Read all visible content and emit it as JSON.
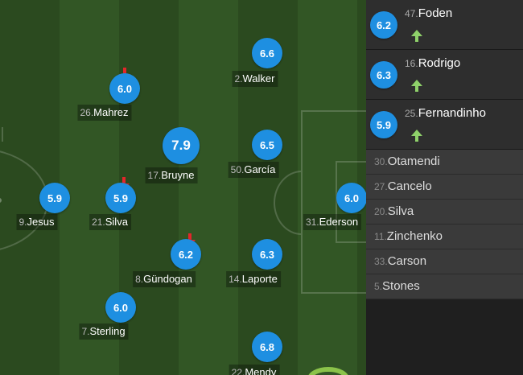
{
  "colors": {
    "rating": "#1e8fe1",
    "sub_out_arrow": "#e3262b",
    "sub_in_arrow": "#8fd16a",
    "pitch_dark": "#2b4a1f",
    "pitch_light": "#325625"
  },
  "lineup": [
    {
      "id": "mahrez",
      "number": "26.",
      "name": "Mahrez",
      "rating": "6.0",
      "subbed_off": true
    },
    {
      "id": "walker",
      "number": "2.",
      "name": "Walker",
      "rating": "6.6"
    },
    {
      "id": "bruyne",
      "number": "17.",
      "name": "Bruyne",
      "rating": "7.9",
      "top_rated": true
    },
    {
      "id": "garcia",
      "number": "50.",
      "name": "García",
      "rating": "6.5"
    },
    {
      "id": "jesus",
      "number": "9.",
      "name": "Jesus",
      "rating": "5.9"
    },
    {
      "id": "silva",
      "number": "21.",
      "name": "Silva",
      "rating": "5.9",
      "subbed_off": true
    },
    {
      "id": "ederson",
      "number": "31.",
      "name": "Ederson",
      "rating": "6.0"
    },
    {
      "id": "gundogan",
      "number": "8.",
      "name": "Gündogan",
      "rating": "6.2",
      "subbed_off": true
    },
    {
      "id": "laporte",
      "number": "14.",
      "name": "Laporte",
      "rating": "6.3"
    },
    {
      "id": "sterling",
      "number": "7.",
      "name": "Sterling",
      "rating": "6.0"
    },
    {
      "id": "mendy",
      "number": "22.",
      "name": "Mendy",
      "rating": "6.8"
    }
  ],
  "substitutes_in": [
    {
      "number": "47.",
      "name": "Foden",
      "rating": "6.2"
    },
    {
      "number": "16.",
      "name": "Rodrigo",
      "rating": "6.3"
    },
    {
      "number": "25.",
      "name": "Fernandinho",
      "rating": "5.9"
    }
  ],
  "bench": [
    {
      "number": "30.",
      "name": "Otamendi"
    },
    {
      "number": "27.",
      "name": "Cancelo"
    },
    {
      "number": "20.",
      "name": "Silva"
    },
    {
      "number": "11.",
      "name": "Zinchenko"
    },
    {
      "number": "33.",
      "name": "Carson"
    },
    {
      "number": "5.",
      "name": "Stones"
    }
  ]
}
